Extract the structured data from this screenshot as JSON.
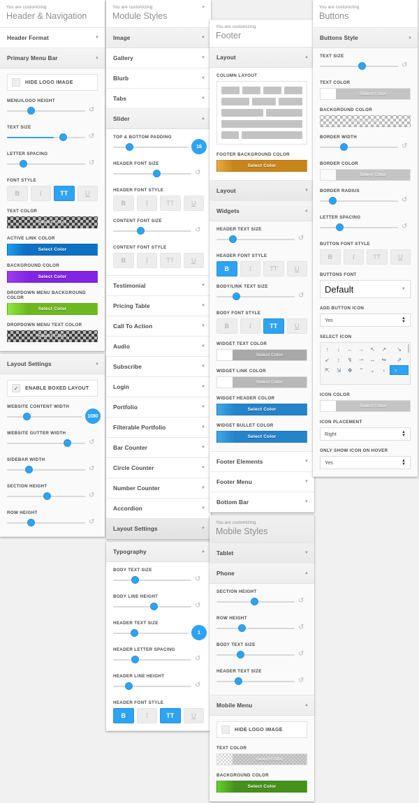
{
  "columns": {
    "header_nav": {
      "customizing_label": "You are customizing",
      "title": "Header & Navigation",
      "sections": {
        "header_format": "Header Format",
        "primary_menu_bar": "Primary Menu Bar",
        "layout_settings": "Layout Settings"
      },
      "hide_logo_image": "HIDE LOGO IMAGE",
      "sliders": [
        {
          "label": "MENU/LOGO HEIGHT",
          "pos": 22,
          "fill": 0,
          "badge": null
        },
        {
          "label": "TEXT SIZE",
          "pos": 58,
          "fill": 58,
          "badge": null
        },
        {
          "label": "LETTER SPACING",
          "pos": 14,
          "fill": 0,
          "badge": null
        }
      ],
      "font_style_label": "FONT STYLE",
      "font_style_buttons": [
        "B",
        "I",
        "TT",
        "U"
      ],
      "font_style_active": "TT",
      "colors": [
        {
          "label": "TEXT COLOR",
          "value": "checker-dark",
          "caption": "Select Color"
        },
        {
          "label": "ACTIVE LINK COLOR",
          "value": "#0c71c3",
          "caption": "Select Color"
        },
        {
          "label": "BACKGROUND COLOR",
          "value": "#8224e3",
          "caption": "Select Color"
        },
        {
          "label": "DROPDOWN MENU BACKGROUND COLOR",
          "value": "#7cda24",
          "caption": "Select Color"
        },
        {
          "label": "DROPDOWN MENU TEXT COLOR",
          "value": "checker-dark",
          "caption": "Select Color"
        }
      ],
      "enable_boxed_layout": "ENABLE BOXED LAYOUT",
      "layout_sliders": [
        {
          "label": "WEBSITE CONTENT WIDTH",
          "pos": 18,
          "fill": 0,
          "badge": "1080"
        },
        {
          "label": "WEBSITE GUTTER WIDTH",
          "pos": 62,
          "fill": 0,
          "badge": null
        },
        {
          "label": "SIDEBAR WIDTH",
          "pos": 20,
          "fill": 0,
          "badge": null
        },
        {
          "label": "SECTION HEIGHT",
          "pos": 40,
          "fill": 0,
          "badge": null
        },
        {
          "label": "ROW HEIGHT",
          "pos": 22,
          "fill": 0,
          "badge": null
        }
      ]
    },
    "module_styles": {
      "customizing_label": "You are customizing",
      "title": "Module Styles",
      "modules_top": [
        "Image",
        "Gallery",
        "Blurb",
        "Tabs"
      ],
      "slider_section": "Slider",
      "slider_fields": [
        {
          "label": "TOP & BOTTOM PADDING",
          "pos": 14,
          "badge": "16"
        },
        {
          "label": "HEADER FONT SIZE",
          "pos": 44,
          "badge": null
        }
      ],
      "header_font_style_label": "HEADER FONT STYLE",
      "content_font_size": {
        "label": "CONTENT FONT SIZE",
        "pos": 26
      },
      "content_font_style_label": "CONTENT FONT STYLE",
      "font_style_buttons": [
        "B",
        "I",
        "TT",
        "U"
      ],
      "modules_bottom": [
        "Testimonial",
        "Pricing Table",
        "Call To Action",
        "Audio",
        "Subscribe",
        "Login",
        "Portfolio",
        "Filterable Portfolio",
        "Bar Counter",
        "Circle Counter",
        "Number Counter",
        "Accordion"
      ],
      "layout_settings": "Layout Settings",
      "typography": "Typography",
      "typography_sliders": [
        {
          "label": "BODY TEXT SIZE",
          "pos": 20,
          "badge": null
        },
        {
          "label": "BODY LINE HEIGHT",
          "pos": 41,
          "badge": null
        },
        {
          "label": "HEADER TEXT SIZE",
          "pos": 19,
          "badge": "1"
        },
        {
          "label": "HEADER LETTER SPACING",
          "pos": 20,
          "badge": null
        },
        {
          "label": "HEADER LINE HEIGHT",
          "pos": 13,
          "badge": null
        }
      ],
      "typography_font_style_label": "HEADER FONT STYLE",
      "typography_font_active": [
        "B",
        "TT"
      ]
    },
    "footer": {
      "customizing_label": "You are customizing",
      "title": "Footer",
      "sections": {
        "layout": "Layout",
        "layout2": "Layout",
        "widgets": "Widgets",
        "footer_elements": "Footer Elements",
        "footer_menu": "Footer Menu",
        "bottom_bar": "Bottom Bar"
      },
      "column_layout_label": "COLUMN LAYOUT",
      "column_layout_rows": [
        [
          1,
          1,
          1,
          1
        ],
        [
          1.4,
          1.2,
          1.2
        ],
        [
          1.5,
          1.3
        ],
        [
          1
        ],
        [
          0.55,
          1.9
        ]
      ],
      "footer_bg_color": {
        "label": "FOOTER BACKGROUND COLOR",
        "value": "#dd9933",
        "caption": "Select Color"
      },
      "widget_sliders": [
        {
          "label": "HEADER TEXT SIZE",
          "pos": 14
        },
        {
          "label": "BODY/LINK TEXT SIZE",
          "pos": 18
        }
      ],
      "header_font_style_label": "HEADER FONT STYLE",
      "header_font_active": "B",
      "body_font_style_label": "BODY FONT STYLE",
      "body_font_active": "TT",
      "font_style_buttons": [
        "B",
        "I",
        "TT",
        "U"
      ],
      "widget_colors": [
        {
          "label": "WIDGET TEXT COLOR",
          "value": "#a8a8a8",
          "caption": "Select Color"
        },
        {
          "label": "WIDGET LINK COLOR",
          "value": "#b3b3b3",
          "caption": "Select Color"
        },
        {
          "label": "WIDGET HEADER COLOR",
          "value": "#2a8fd4",
          "caption": "Select Color"
        },
        {
          "label": "WIDGET BULLET COLOR",
          "value": "#2a8fd4",
          "caption": "Select Color"
        }
      ]
    },
    "mobile_styles": {
      "customizing_label": "You are customizing",
      "title": "Mobile Styles",
      "sections": {
        "tablet": "Tablet",
        "phone": "Phone",
        "mobile_menu": "Mobile Menu"
      },
      "phone_sliders": [
        {
          "label": "SECTION HEIGHT",
          "pos": 38
        },
        {
          "label": "ROW HEIGHT",
          "pos": 24
        },
        {
          "label": "BODY TEXT SIZE",
          "pos": 22
        },
        {
          "label": "HEADER TEXT SIZE",
          "pos": 20
        }
      ],
      "hide_logo_image": "HIDE LOGO IMAGE",
      "text_color": {
        "label": "TEXT COLOR",
        "value": "checker-grey",
        "caption": "Select Color"
      },
      "background_color": {
        "label": "BACKGROUND COLOR",
        "value": "#4caf1e",
        "caption": "Select Color"
      }
    },
    "buttons": {
      "customizing_label": "You are customizing",
      "title": "Buttons",
      "section": "Buttons Style",
      "sliders": [
        {
          "label": "TEXT SIZE",
          "pos": 42
        },
        {
          "label": "BORDER WIDTH",
          "pos": 22
        },
        {
          "label": "BORDER RADIUS",
          "pos": 10
        },
        {
          "label": "LETTER SPACING",
          "pos": 18
        }
      ],
      "text_color": {
        "label": "TEXT COLOR",
        "value": "#c4c4c4",
        "caption": "Select Color"
      },
      "background_color": {
        "label": "BACKGROUND COLOR",
        "value": "checker-light",
        "caption": "Select Color"
      },
      "border_color": {
        "label": "BORDER COLOR",
        "value": "#c4c4c4",
        "caption": "Select Color"
      },
      "button_font_style_label": "BUTTON FONT STYLE",
      "font_style_buttons": [
        "B",
        "I",
        "TT",
        "U"
      ],
      "buttons_font": {
        "label": "BUTTONS FONT",
        "value": "Default"
      },
      "add_button_icon": {
        "label": "ADD BUTTON ICON",
        "value": "Yes"
      },
      "select_icon_label": "SELECT ICON",
      "icons": [
        "↑",
        "↓",
        "←",
        "→",
        "↖",
        "↗",
        "↘",
        "↙",
        "↕",
        "↯",
        "⇀",
        "↔",
        "↬",
        "⇗",
        "⇱",
        "⇲",
        "✥",
        "⌃",
        "⌄",
        "‹",
        "›"
      ],
      "selected_icon_index": 20,
      "icon_color": {
        "label": "ICON COLOR",
        "value": "#c4c4c4",
        "caption": "Select Color"
      },
      "icon_placement": {
        "label": "ICON PLACEMENT",
        "value": "Right"
      },
      "only_show_icon_on_hover": {
        "label": "ONLY SHOW ICON ON HOVER",
        "value": "Yes"
      }
    }
  }
}
